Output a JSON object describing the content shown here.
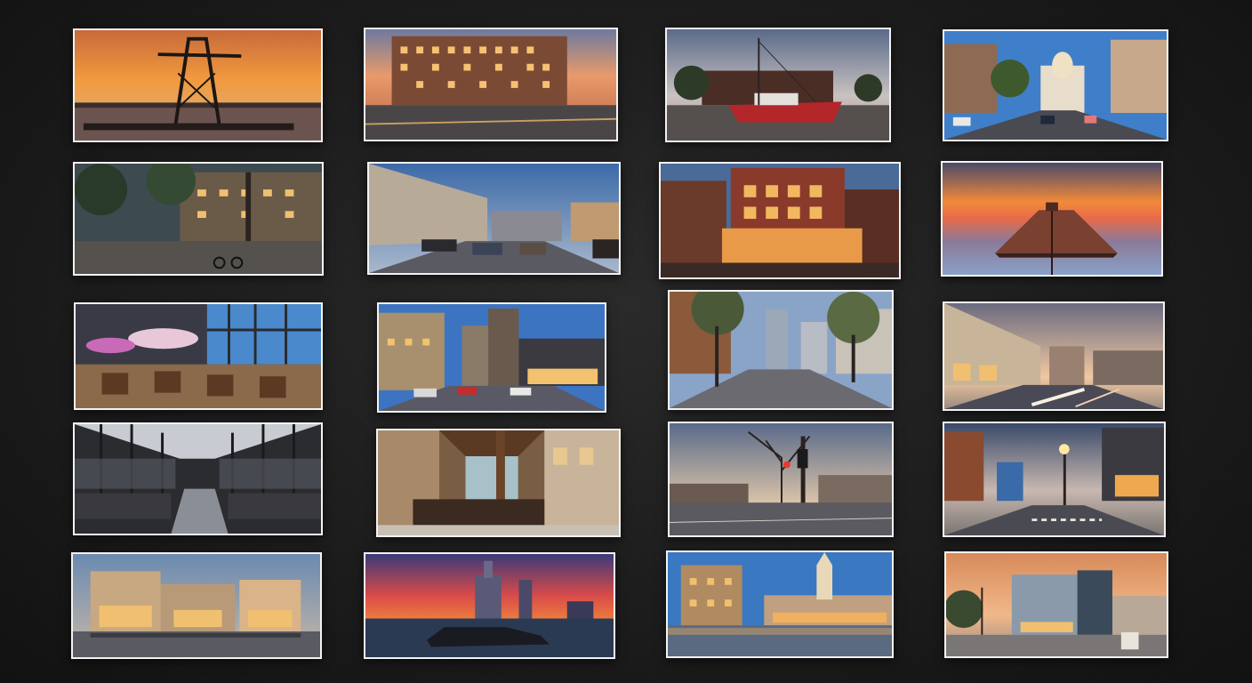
{
  "gallery": {
    "background_color": "#1a1a1a",
    "border_color": "#f2f2f2",
    "photos": [
      {
        "name": "transmission-tower-sunset"
      },
      {
        "name": "brick-hotel-dusk"
      },
      {
        "name": "red-boat-on-plaza"
      },
      {
        "name": "domed-avenue-traffic"
      },
      {
        "name": "tree-lined-street-bicycles"
      },
      {
        "name": "office-boulevard-cars"
      },
      {
        "name": "lit-brick-restaurant"
      },
      {
        "name": "pier-sunset-sea"
      },
      {
        "name": "cafe-interior-umbrellas"
      },
      {
        "name": "downtown-street-traffic"
      },
      {
        "name": "wide-plaza-trees"
      },
      {
        "name": "victorian-street-light-trails"
      },
      {
        "name": "glass-atrium-interior"
      },
      {
        "name": "industrial-loft-interior"
      },
      {
        "name": "bare-tree-traffic-light"
      },
      {
        "name": "evening-street-lamp"
      },
      {
        "name": "historic-palace-facade"
      },
      {
        "name": "skyline-sunset-car"
      },
      {
        "name": "waterfront-clock-tower"
      },
      {
        "name": "modern-building-sunset"
      }
    ]
  }
}
